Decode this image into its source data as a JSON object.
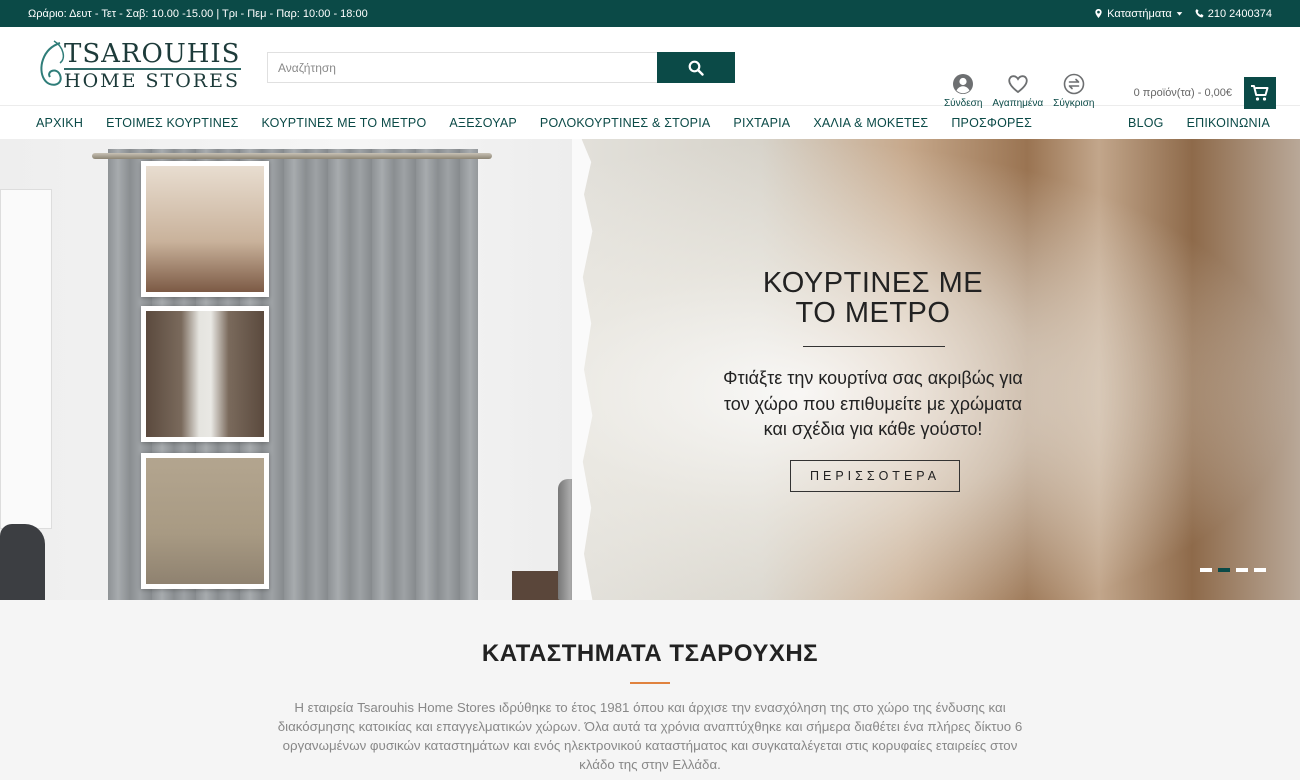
{
  "topbar": {
    "hours": "Ωράριο: Δευτ - Τετ - Σαβ: 10.00 -15.00 | Τρι - Πεμ - Παρ: 10:00 - 18:00",
    "stores_label": "Καταστήματα",
    "phone": "210 2400374"
  },
  "logo": {
    "line1": "TSAROUHIS",
    "line2": "HOME STORES"
  },
  "search": {
    "placeholder": "Αναζήτηση"
  },
  "header_icons": {
    "login": "Σύνδεση",
    "favorites": "Αγαπημένα",
    "compare": "Σύγκριση"
  },
  "cart": {
    "summary": "0 προϊόν(τα) - 0,00€"
  },
  "nav": {
    "items": [
      "ΑΡΧΙΚΗ",
      "ΕΤΟΙΜΕΣ ΚΟΥΡΤΙΝΕΣ",
      "ΚΟΥΡΤΙΝΕΣ ΜΕ ΤΟ ΜΕΤΡΟ",
      "ΑΞΕΣΟΥΑΡ",
      "ΡΟΛΟΚΟΥΡΤΙΝΕΣ & ΣΤΟΡΙΑ",
      "ΡΙΧΤΑΡΙΑ",
      "ΧΑΛΙΑ & ΜΟΚΕΤΕΣ",
      "ΠΡΟΣΦΟΡΕΣ"
    ],
    "right_items": [
      "BLOG",
      "ΕΠΙΚΟΙΝΩΝΙΑ"
    ]
  },
  "hero": {
    "title_line1": "ΚΟΥΡΤΙΝΕΣ ΜΕ",
    "title_line2": "ΤΟ ΜΕΤΡΟ",
    "text_line1": "Φτιάξτε την κουρτίνα σας ακριβώς για",
    "text_line2": "τον χώρο που επιθυμείτε με χρώματα",
    "text_line3": "και σχέδια για κάθε γούστο!",
    "button": "ΠΕΡΙΣΣΟΤΕΡΑ",
    "slides_count": 4,
    "active_slide": 2
  },
  "about": {
    "title": "ΚΑΤΑΣΤΗΜΑΤΑ ΤΣΑΡΟΥΧΗΣ",
    "text": "Η εταιρεία Tsarouhis Home Stores ιδρύθηκε το έτος 1981 όπου και άρχισε την ενασχόληση της στο χώρο της ένδυσης και διακόσμησης κατοικίας και επαγγελματικών χώρων. Όλα αυτά τα χρόνια αναπτύχθηκε και σήμερα διαθέτει ένα πλήρες δίκτυο 6 οργανωμένων φυσικών καταστημάτων και ενός ηλεκτρονικού καταστήματος και συγκαταλέγεται στις κορυφαίες εταιρείες στον κλάδο της στην Ελλάδα."
  },
  "colors": {
    "brand": "#0b4a47",
    "accent": "#e0823e"
  }
}
